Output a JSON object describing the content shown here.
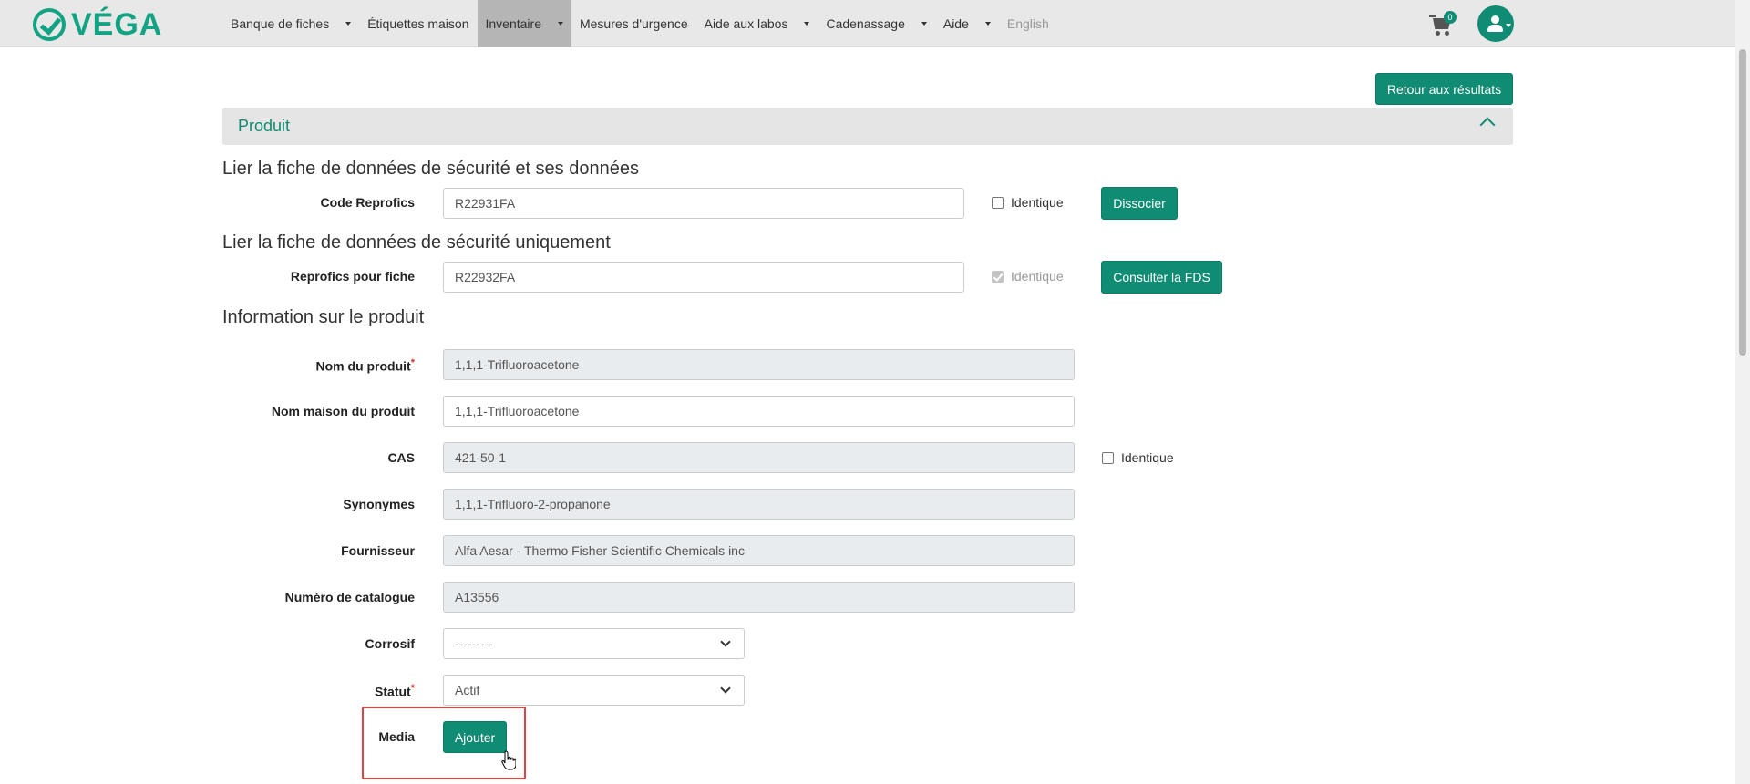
{
  "brand": {
    "name": "VÉGA"
  },
  "nav": {
    "items": [
      {
        "label": "Banque de fiches",
        "caret": true
      },
      {
        "label": "Étiquettes maison",
        "caret": false
      },
      {
        "label": "Inventaire",
        "caret": true,
        "active": true
      },
      {
        "label": "Mesures d'urgence",
        "caret": false
      },
      {
        "label": "Aide aux labos",
        "caret": true
      },
      {
        "label": "Cadenassage",
        "caret": true
      },
      {
        "label": "Aide",
        "caret": true
      },
      {
        "label": "English",
        "caret": false,
        "muted": true
      }
    ],
    "cart_count": "0"
  },
  "top_actions": {
    "back_label": "Retour aux résultats"
  },
  "panel": {
    "title": "Produit"
  },
  "link_all": {
    "heading": "Lier la fiche de données de sécurité et ses données",
    "label": "Code Reprofics",
    "value": "R22931FA",
    "identical_label": "Identique",
    "identical_checked": false,
    "button_label": "Dissocier"
  },
  "link_sheet": {
    "heading": "Lier la fiche de données de sécurité uniquement",
    "label": "Reprofics pour fiche",
    "value": "R22932FA",
    "identical_label": "Identique",
    "identical_checked": true,
    "button_label": "Consulter la FDS"
  },
  "product_info": {
    "heading": "Information sur le produit",
    "fields": {
      "name": {
        "label": "Nom du produit",
        "required": "*",
        "value": "1,1,1-Trifluoroacetone"
      },
      "house_name": {
        "label": "Nom maison du produit",
        "value": "1,1,1-Trifluoroacetone"
      },
      "cas": {
        "label": "CAS",
        "value": "421-50-1",
        "identical_label": "Identique"
      },
      "synonyms": {
        "label": "Synonymes",
        "value": "1,1,1-Trifluoro-2-propanone"
      },
      "supplier": {
        "label": "Fournisseur",
        "value": "Alfa Aesar - Thermo Fisher Scientific Chemicals inc"
      },
      "catalog": {
        "label": "Numéro de catalogue",
        "value": "A13556"
      },
      "corrosive": {
        "label": "Corrosif",
        "value": "---------"
      },
      "status": {
        "label": "Statut",
        "required": "*",
        "value": "Actif"
      },
      "media": {
        "label": "Media",
        "button_label": "Ajouter"
      }
    }
  },
  "colors": {
    "brand": "#11a383",
    "button": "#0f8c73",
    "highlight": "#e04343"
  }
}
